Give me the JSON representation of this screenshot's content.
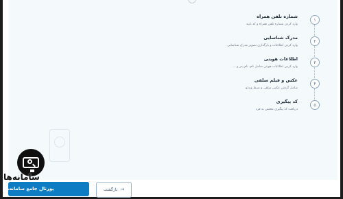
{
  "steps": [
    {
      "number": "۱",
      "title": "شماره تلفن همراه",
      "description": "وارد کردن شماره تلفن همراه و کد تایید"
    },
    {
      "number": "۲",
      "title": "مدرک شناسایی",
      "description": "وارد کردن اطلاعات و بارگذاری تصویر مدرک شناسایی"
    },
    {
      "number": "۳",
      "title": "اطلاعات هویتی",
      "description": "وارد کردن اطلاعات هویتی شامل نام، نام پدر و ..."
    },
    {
      "number": "۴",
      "title": "عکس و فیلم سلفی",
      "description": "شامل گرفتن عکس سلفی و ضبط ویدئو"
    },
    {
      "number": "۵",
      "title": "کد پیگیری",
      "description": "دریافت کد پیگیری مختص به فرد"
    }
  ],
  "footer": {
    "back_label": "بازگشت",
    "back_icon": "arrow-right-icon",
    "primary_label": ""
  },
  "watermark": {
    "title": "سامانه‌ها",
    "subtitle": "پورتال جامع سامانه‌ها",
    "icon": "search-monitor-icon"
  },
  "colors": {
    "panel_bg": "#f4f9fc",
    "primary": "#0d7cc3",
    "step_border": "#8ea6bd",
    "frame": "#1c1c1c"
  }
}
